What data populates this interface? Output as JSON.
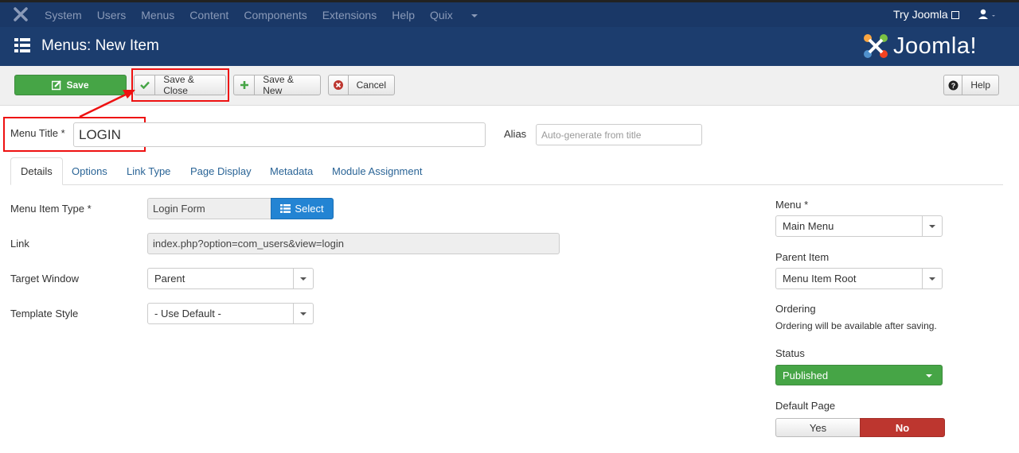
{
  "topnav": {
    "items": [
      "System",
      "Users",
      "Menus",
      "Content",
      "Components",
      "Extensions",
      "Help",
      "Quix"
    ],
    "try_joomla": "Try Joomla"
  },
  "header": {
    "title": "Menus: New Item",
    "logo_text": "Joomla!"
  },
  "toolbar": {
    "save": "Save",
    "save_close": "Save & Close",
    "save_new": "Save & New",
    "cancel": "Cancel",
    "help": "Help"
  },
  "form": {
    "menu_title_label": "Menu Title *",
    "menu_title_value": "LOGIN",
    "alias_label": "Alias",
    "alias_placeholder": "Auto-generate from title"
  },
  "tabs": [
    "Details",
    "Options",
    "Link Type",
    "Page Display",
    "Metadata",
    "Module Assignment"
  ],
  "details": {
    "item_type_label": "Menu Item Type *",
    "item_type_value": "Login Form",
    "select_button": "Select",
    "link_label": "Link",
    "link_value": "index.php?option=com_users&view=login",
    "target_label": "Target Window",
    "target_value": "Parent",
    "template_label": "Template Style",
    "template_value": "- Use Default -"
  },
  "sidebar": {
    "menu_label": "Menu *",
    "menu_value": "Main Menu",
    "parent_label": "Parent Item",
    "parent_value": "Menu Item Root",
    "ordering_label": "Ordering",
    "ordering_note": "Ordering will be available after saving.",
    "status_label": "Status",
    "status_value": "Published",
    "default_label": "Default Page",
    "default_yes": "Yes",
    "default_no": "No"
  },
  "colors": {
    "topbar": "#1a3867",
    "header": "#1c3d6e",
    "save_green": "#46a546",
    "no_red": "#bd362f",
    "annotation_red": "#ee1111"
  }
}
